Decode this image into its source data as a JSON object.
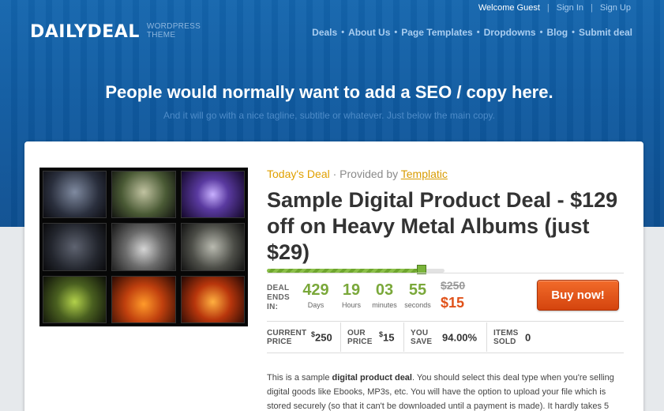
{
  "topbar": {
    "welcome": "Welcome Guest",
    "sep1": "|",
    "sign_in": "Sign In",
    "sep2": "|",
    "sign_up": "Sign Up"
  },
  "logo": {
    "main": "DAILYDEAL",
    "sub": "WORDPRESS THEME"
  },
  "nav": {
    "items": [
      "Deals",
      "About Us",
      "Page Templates",
      "Dropdowns",
      "Blog",
      "Submit deal"
    ],
    "separator": "•"
  },
  "hero": {
    "headline": "People would normally want to add a SEO / copy here.",
    "tagline": "And it will go with a nice tagline, subtitle or whatever. Just below the main copy."
  },
  "deal": {
    "todays_deal": "Today's Deal",
    "separator": "·",
    "provided_by": "Provided by",
    "provider": "Templatic",
    "title": "Sample Digital Product Deal - $129 off on Heavy Metal Albums (just $29)",
    "progress_fraction": 0.87,
    "ends_label": "DEAL ENDS IN:",
    "countdown": [
      {
        "value": "429",
        "unit": "Days"
      },
      {
        "value": "19",
        "unit": "Hours"
      },
      {
        "value": "03",
        "unit": "minutes"
      },
      {
        "value": "55",
        "unit": "seconds"
      }
    ],
    "old_price": "$250",
    "new_price": "$15",
    "buy_label": "Buy now!",
    "stats": [
      {
        "label": "CURRENT PRICE",
        "currency": "$",
        "value": "250"
      },
      {
        "label": "OUR PRICE",
        "currency": "$",
        "value": "15"
      },
      {
        "label": "YOU SAVE",
        "currency": "",
        "value": "94.00%"
      },
      {
        "label": "ITEMS SOLD",
        "currency": "",
        "value": "0"
      }
    ],
    "description": {
      "before": "This is a sample ",
      "bold": "digital product deal",
      "after": ". You should select this deal type when you're selling digital goods like Ebooks, MP3s, etc. You will have the option to upload your file which is stored securely (so that it can't be downloaded until a payment is made). It hardly takes 5"
    }
  },
  "colors": {
    "hero_blue": "#1465ad",
    "accent_green": "#7aa83a",
    "price_orange": "#e0521a",
    "button_orange": "#e85a1e",
    "deal_yellow": "#e0a000"
  }
}
